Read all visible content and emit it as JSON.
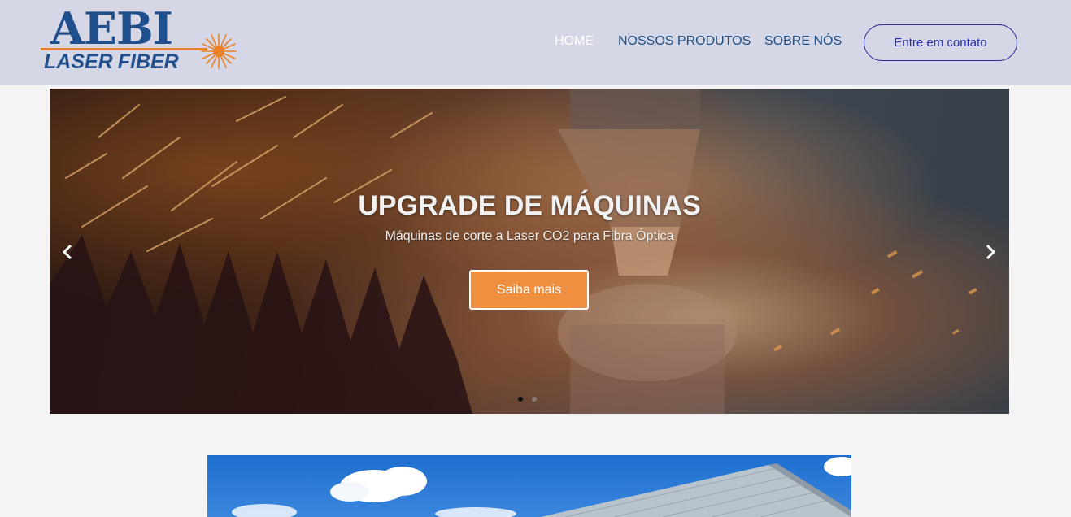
{
  "logo": {
    "line1": "AEBI",
    "line2a": "LASER",
    "line2b": "FIBER",
    "icon": "laser-star-icon"
  },
  "nav": {
    "items": [
      {
        "label": "HOME",
        "active": true
      },
      {
        "label": "NOSSOS PRODUTOS",
        "active": false
      },
      {
        "label": "SOBRE NÓS",
        "active": false
      }
    ],
    "contact_label": "Entre em contato"
  },
  "carousel": {
    "title": "UPGRADE DE MÁQUINAS",
    "subtitle": "Máquinas de corte a Laser CO2 para Fibra Óptica",
    "button_label": "Saiba mais",
    "prev_icon": "chevron-left-icon",
    "next_icon": "chevron-right-icon",
    "slide_count": 2,
    "active_slide": 1
  },
  "colors": {
    "header_bg": "#d6d7e6",
    "brand_blue": "#1f4f8c",
    "brand_orange": "#e9802a",
    "cta_orange": "#ef9040",
    "page_bg": "#f3f4f3"
  }
}
